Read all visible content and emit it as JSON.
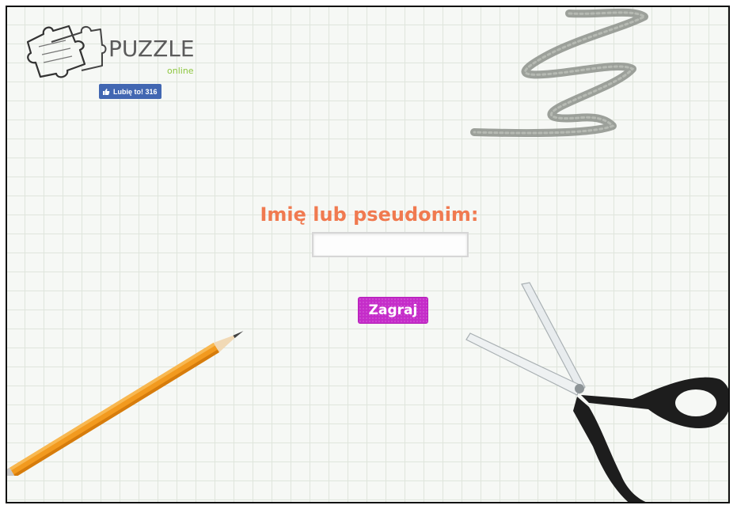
{
  "logo": {
    "title": "PUZZLE",
    "subtitle": "online",
    "icon": "puzzle-pieces-icon"
  },
  "facebook": {
    "like_label": "Lubię to! 316",
    "icon": "thumbs-up-icon",
    "color": "#4267b2"
  },
  "form": {
    "heading": "Imię lub pseudonim:",
    "name_value": "",
    "name_placeholder": "",
    "play_label": "Zagraj"
  },
  "colors": {
    "heading": "#f07a50",
    "play_button": "#c52cc9"
  },
  "decorations": {
    "items": [
      "pencil",
      "scissors",
      "chalk-scribble"
    ]
  }
}
